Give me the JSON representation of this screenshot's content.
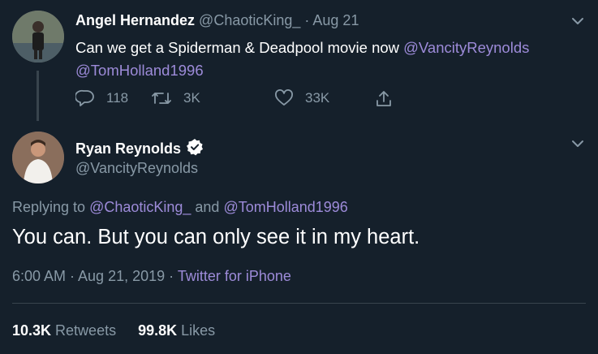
{
  "tweet1": {
    "author_name": "Angel Hernandez",
    "handle": "@ChaoticKing_",
    "separator": " · ",
    "date": "Aug 21",
    "text_prefix": "Can we get a Spiderman & Deadpool movie now ",
    "mention1": "@VancityReynolds",
    "mention2": "@TomHolland1996",
    "replies": "118",
    "retweets": "3K",
    "likes": "33K"
  },
  "tweet2": {
    "author_name": "Ryan Reynolds",
    "handle": "@VancityReynolds",
    "replying_prefix": "Replying to ",
    "reply_mention1": "@ChaoticKing_",
    "reply_and": " and ",
    "reply_mention2": "@TomHolland1996",
    "text": "You can. But you can only see it in my heart.",
    "time_date": "6:00 AM · Aug 21, 2019",
    "meta_sep": " · ",
    "client": "Twitter for iPhone",
    "retweet_count": "10.3K",
    "retweet_label": " Retweets",
    "like_count": "99.8K",
    "like_label": " Likes"
  },
  "colors": {
    "background": "#15202b",
    "accent_link": "#9d8bd9",
    "muted": "#8899a6"
  },
  "icons": [
    "chevron-down-icon",
    "reply-icon",
    "retweet-icon",
    "heart-icon",
    "share-icon",
    "verified-badge-icon"
  ]
}
